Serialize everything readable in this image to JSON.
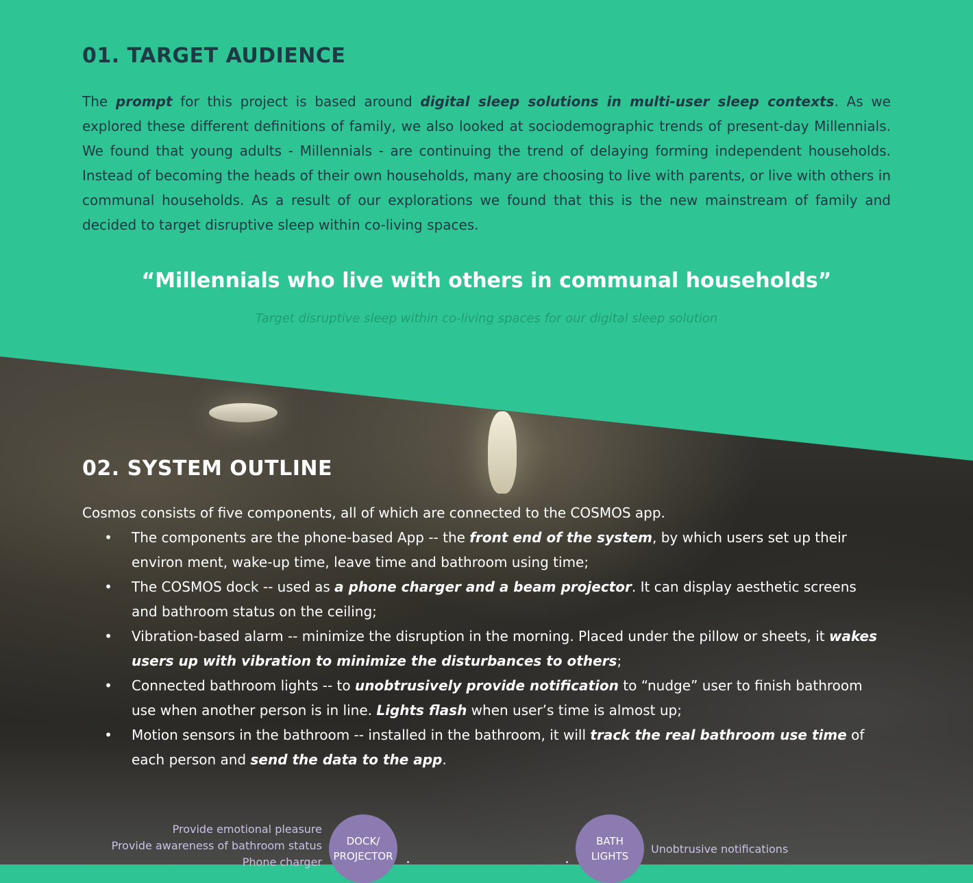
{
  "section1": {
    "heading": "01. TARGET AUDIENCE",
    "intro": {
      "t1": "The ",
      "b1": "prompt",
      "t2": " for this project is based around ",
      "b2": "digital sleep solutions in multi-user sleep contexts",
      "t3": ". As we explored these different definitions of family, we also looked at sociodemographic trends of present-day Millennials. We found that young adults - Millennials - are continuing the trend of delaying forming independent households. Instead of becoming the heads of their own households, many are choosing to live with parents, or live with others in communal households. As a result of our explorations we found that this is the new mainstream of family and decided to target disruptive sleep within co-living spaces."
    },
    "quote": "“Millennials who live with others in communal households”",
    "quote_sub": "Target disruptive sleep within co-living spaces for our digital sleep solution"
  },
  "section2": {
    "heading": "02. SYSTEM OUTLINE",
    "intro": "Cosmos consists of five components, all of which are connected to the COSMOS app.",
    "bullet_glyph": "•",
    "bullets": [
      {
        "t1": "The components are the phone-based App -- the ",
        "b1": "front end of the system",
        "t2": ", by which users set up their environ ment, wake-up time, leave time and bathroom using time;"
      },
      {
        "t1": "The COSMOS dock -- used as ",
        "b1": "a phone charger and a beam projector",
        "t2": ". It can display aesthetic screens and bathroom status on the ceiling;"
      },
      {
        "t1": "Vibration-based alarm -- minimize the disruption in the morning. Placed under the pillow or sheets, it ",
        "b1": "wakes users up with vibration to minimize the disturbances to others",
        "t2": ";"
      },
      {
        "t1": "Connected bathroom lights -- to ",
        "b1": "unobtrusively provide notification",
        "t2": " to “nudge” user to finish bathroom use when another person is in line. ",
        "b2": "Lights flash",
        "t3": " when user’s time is almost up;"
      },
      {
        "t1": "Motion sensors in the bathroom -- installed in the bathroom, it will ",
        "b1": "track the real bathroom use time",
        "t2": " of each person and ",
        "b2": "send the data to the app",
        "t3": "."
      }
    ]
  },
  "diagram": {
    "dock_notes": [
      "Provide emotional pleasure",
      "Provide awareness of bathroom status",
      "Phone charger"
    ],
    "dock_label": [
      "DOCK/",
      "PROJECTOR"
    ],
    "bath_label": [
      "BATH",
      "LIGHTS"
    ],
    "bath_note": "Unobtrusive notifications"
  },
  "colors": {
    "green": "#2fc493",
    "navy": "#1d3b45",
    "purple": "#8b7bb0"
  }
}
